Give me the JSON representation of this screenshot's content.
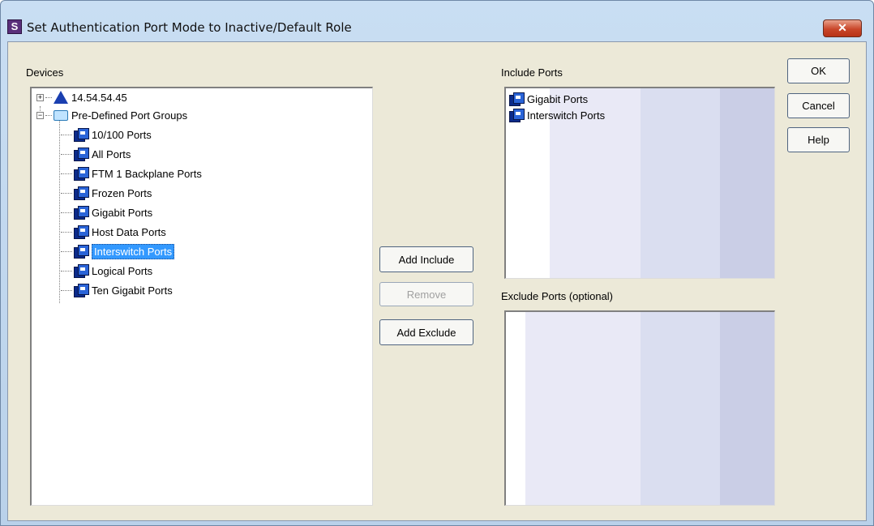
{
  "window": {
    "title": "Set Authentication Port Mode to Inactive/Default Role",
    "app_icon_glyph": "S",
    "close_glyph": "✕"
  },
  "devices": {
    "label": "Devices",
    "tree": [
      {
        "text": "14.54.54.45",
        "icon": "device-triangle-icon",
        "expander": "+"
      },
      {
        "text": "Pre-Defined Port Groups",
        "icon": "folder-icon",
        "expander": "−"
      },
      {
        "text": "10/100 Ports",
        "icon": "port-group-icon"
      },
      {
        "text": "All Ports",
        "icon": "port-group-icon"
      },
      {
        "text": "FTM 1 Backplane Ports",
        "icon": "port-group-icon"
      },
      {
        "text": "Frozen Ports",
        "icon": "port-group-icon"
      },
      {
        "text": "Gigabit Ports",
        "icon": "port-group-icon"
      },
      {
        "text": "Host Data Ports",
        "icon": "port-group-icon"
      },
      {
        "text": "Interswitch Ports",
        "icon": "port-group-icon",
        "selected": true
      },
      {
        "text": "Logical Ports",
        "icon": "port-group-icon"
      },
      {
        "text": "Ten Gigabit Ports",
        "icon": "port-group-icon"
      }
    ]
  },
  "buttons": {
    "add_include": "Add Include",
    "remove": "Remove",
    "add_exclude": "Add Exclude",
    "ok": "OK",
    "cancel": "Cancel",
    "help": "Help"
  },
  "include_ports": {
    "label": "Include Ports",
    "items": [
      "Gigabit Ports",
      "Interswitch Ports"
    ]
  },
  "exclude_ports": {
    "label": "Exclude Ports (optional)",
    "items": []
  },
  "colors": {
    "selection": "#3399ff",
    "dialog_bg": "#ece9d8",
    "stripe_1": "#e8e8f5",
    "stripe_2": "#d8dcef",
    "stripe_3": "#c9cde6"
  }
}
